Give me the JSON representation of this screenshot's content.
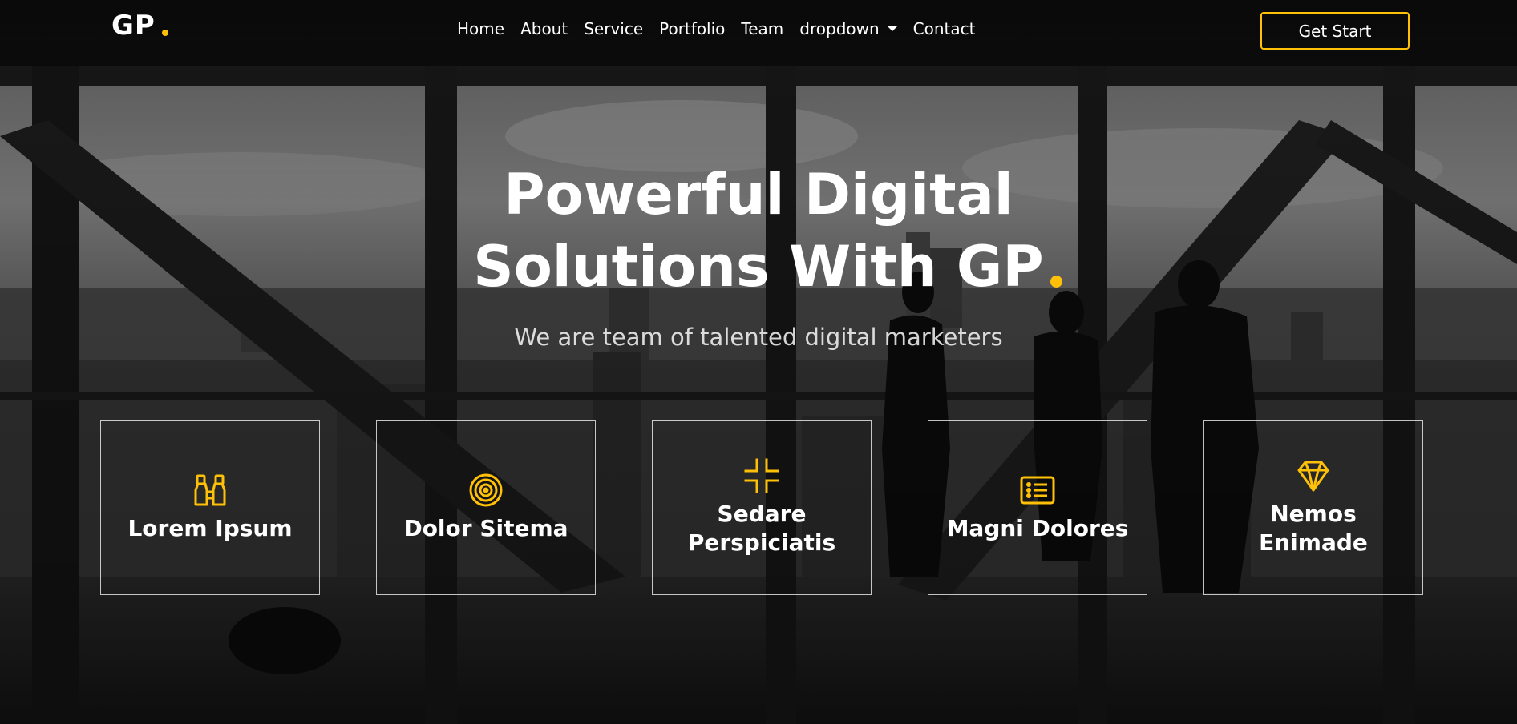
{
  "brand": {
    "logo_text": "GP",
    "accent_color": "#ffc107"
  },
  "nav": {
    "items": [
      {
        "label": "Home"
      },
      {
        "label": "About"
      },
      {
        "label": "Service"
      },
      {
        "label": "Portfolio"
      },
      {
        "label": "Team"
      },
      {
        "label": "dropdown",
        "has_submenu": true
      },
      {
        "label": "Contact"
      }
    ],
    "cta_label": "Get Start"
  },
  "hero": {
    "title_line1": "Powerful Digital",
    "title_line2": "Solutions With GP",
    "subtitle": "We are team of talented digital marketers",
    "background": "black-and-white office with city view and silhouetted people"
  },
  "features": [
    {
      "title": "Lorem Ipsum",
      "icon": "binoculars-icon"
    },
    {
      "title": "Dolor Sitema",
      "icon": "target-icon"
    },
    {
      "title": "Sedare Perspiciatis",
      "icon": "shrink-icon"
    },
    {
      "title": "Magni Dolores",
      "icon": "list-icon"
    },
    {
      "title": "Nemos Enimade",
      "icon": "gem-icon"
    }
  ]
}
